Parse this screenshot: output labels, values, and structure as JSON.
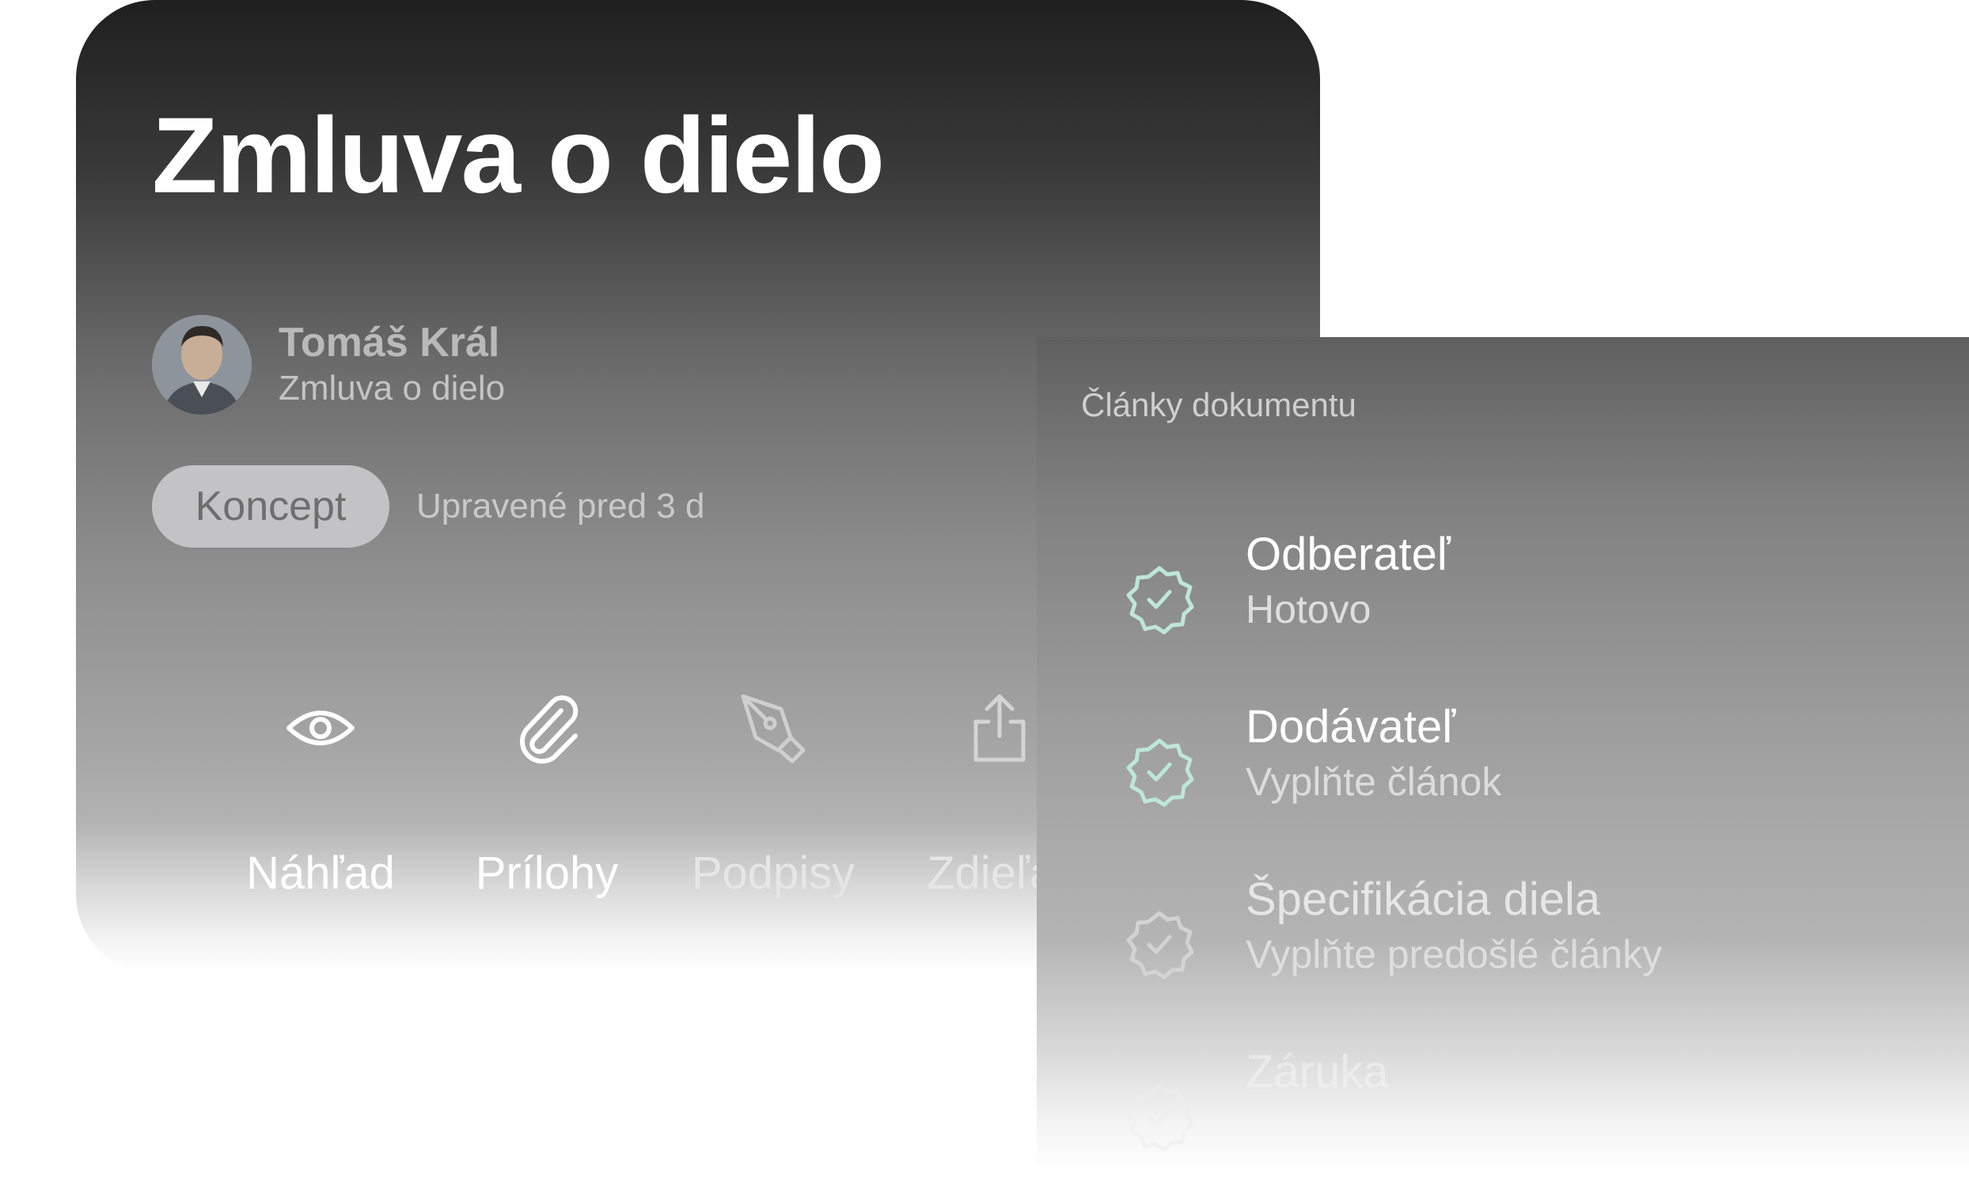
{
  "document": {
    "title": "Zmluva o dielo",
    "author": {
      "name": "Tomáš Král",
      "document": "Zmluva o dielo"
    },
    "status": "Koncept",
    "modified": "Upravené pred 3 d",
    "actions": [
      {
        "label": "Náhľad",
        "icon": "eye-icon",
        "enabled": true
      },
      {
        "label": "Prílohy",
        "icon": "paperclip-icon",
        "enabled": true
      },
      {
        "label": "Podpisy",
        "icon": "pen-nib-icon",
        "enabled": false
      },
      {
        "label": "Zdieľať",
        "icon": "share-icon",
        "enabled": false
      }
    ]
  },
  "articles": {
    "title": "Články dokumentu",
    "items": [
      {
        "name": "Odberateľ",
        "status": "Hotovo",
        "icon": "verified-badge-icon"
      },
      {
        "name": "Dodávateľ",
        "status": "Vyplňte článok",
        "icon": "verified-badge-icon"
      },
      {
        "name": "Špecifikácia diela",
        "status": "Vyplňte predošlé články",
        "icon": "verified-badge-icon"
      },
      {
        "name": "Záruka",
        "status": "",
        "icon": "verified-badge-icon"
      }
    ]
  },
  "colors": {
    "badge_accent": "#bfe6d8",
    "status_badge_bg": "#c3c3c5"
  }
}
